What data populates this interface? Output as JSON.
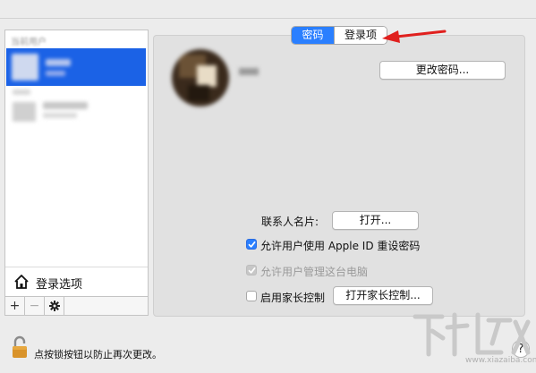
{
  "user_list": {
    "section_header": "当前用户",
    "login_options_label": "登录选项",
    "buttons": {
      "add": "+",
      "remove": "−",
      "gear": "gear-icon"
    }
  },
  "tabs": [
    {
      "label": "密码",
      "selected": true
    },
    {
      "label": "登录项",
      "selected": false
    }
  ],
  "main": {
    "change_password_button": "更改密码...",
    "contact_card_label": "联系人名片:",
    "open_button": "打开...",
    "allow_apple_id_reset": {
      "label": "允许用户使用 Apple ID 重设密码",
      "checked": true
    },
    "allow_admin": {
      "label": "允许用户管理这台电脑",
      "checked": true,
      "disabled": true
    },
    "parental_controls": {
      "label": "启用家长控制",
      "checked": false
    },
    "open_parental_controls_button": "打开家长控制..."
  },
  "footer": {
    "lock_text": "点按锁按钮以防止再次更改。",
    "help": "?"
  },
  "colors": {
    "selection": "#1b62e6",
    "accent": "#2a7fff",
    "annotation_arrow": "#e0201e"
  },
  "watermark": {
    "url": "www.xiazaiba.com"
  }
}
